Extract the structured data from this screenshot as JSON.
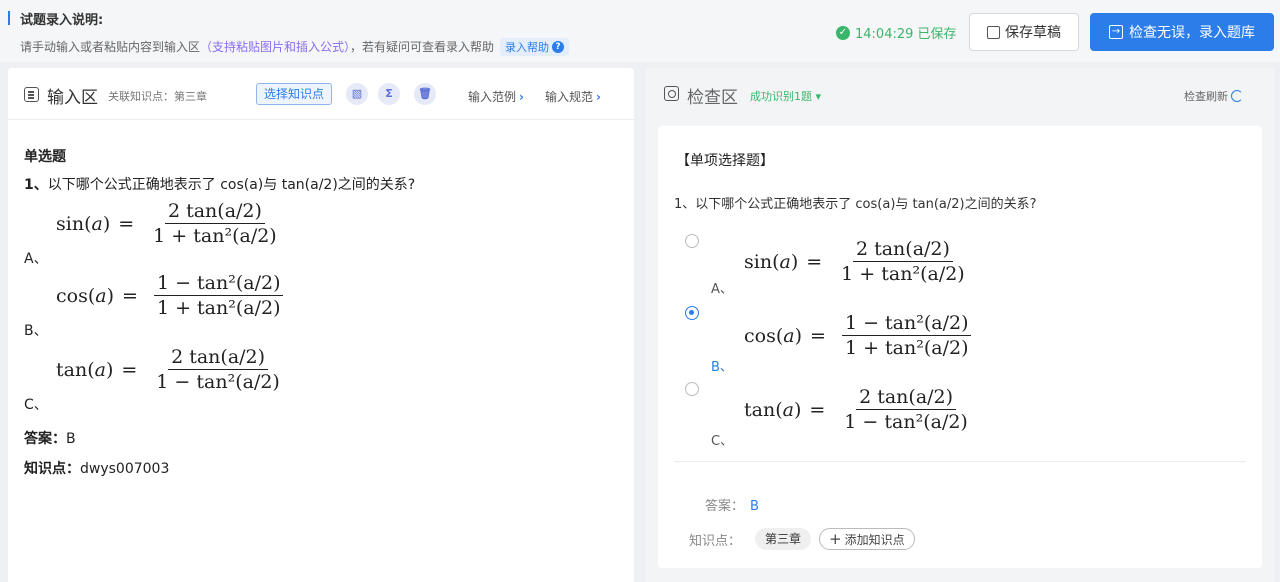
{
  "header": {
    "title": "试题录入说明:",
    "desc_prefix": "请手动输入或者粘贴内容到输入区",
    "desc_highlight": "（支持粘贴图片和插入公式）",
    "desc_suffix": "，若有疑问可查看录入帮助",
    "help_link": "录入帮助",
    "saved_status": "14:04:29 已保存",
    "save_draft_label": "保存草稿",
    "submit_label": "检查无误，录入题库"
  },
  "input_panel": {
    "title": "输入区",
    "related_kp": "关联知识点：第三章",
    "select_kp_button": "选择知识点",
    "example_link": "输入范例",
    "rule_link": "输入规范"
  },
  "check_panel": {
    "title": "检查区",
    "recognized": "成功识别1题",
    "refresh": "检查刷新"
  },
  "question": {
    "type_label": "单选题",
    "card_type_label": "【单项选择题】",
    "stem_index": "1、",
    "stem_text": "以下哪个公式正确地表示了 cos(a)与 tan(a/2)之间的关系?",
    "options": [
      {
        "label": "A、",
        "lhs_fn": "sin",
        "numerator": "2 tan(a/2)",
        "denominator": "1 + tan²(a/2)",
        "selected": false
      },
      {
        "label": "B、",
        "lhs_fn": "cos",
        "numerator": "1 − tan²(a/2)",
        "denominator": "1 + tan²(a/2)",
        "selected": true
      },
      {
        "label": "C、",
        "lhs_fn": "tan",
        "numerator": "2 tan(a/2)",
        "denominator": "1 − tan²(a/2)",
        "selected": false
      }
    ],
    "answer_label": "答案：",
    "answer_value": "B",
    "kp_label": "知识点：",
    "kp_value": "dwys007003",
    "card_answer_label": "答案：",
    "card_kp_label": "知识点：",
    "card_kp_chip": "第三章",
    "add_kp_label": "添加知识点"
  },
  "colors": {
    "primary": "#2b7de9",
    "success": "#3ab66a",
    "highlight": "#8a6cf0"
  }
}
